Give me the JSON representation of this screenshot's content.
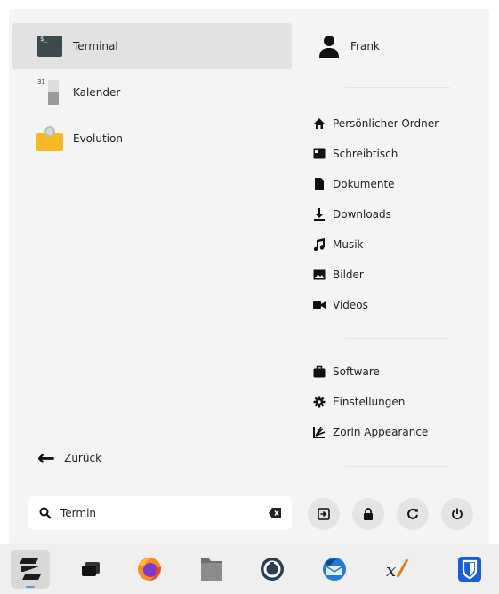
{
  "apps": [
    {
      "label": "Terminal",
      "icon": "terminal-icon",
      "selected": true
    },
    {
      "label": "Kalender",
      "icon": "calendar-icon",
      "selected": false
    },
    {
      "label": "Evolution",
      "icon": "evolution-icon",
      "selected": false
    }
  ],
  "calendar_icon_number": "31",
  "back_label": "Zurück",
  "search": {
    "value": "Termin",
    "placeholder": ""
  },
  "user": {
    "name": "Frank"
  },
  "places": [
    {
      "label": "Persönlicher Ordner",
      "icon": "home-icon"
    },
    {
      "label": "Schreibtisch",
      "icon": "desktop-icon"
    },
    {
      "label": "Dokumente",
      "icon": "document-icon"
    },
    {
      "label": "Downloads",
      "icon": "download-icon"
    },
    {
      "label": "Musik",
      "icon": "music-icon"
    },
    {
      "label": "Bilder",
      "icon": "image-icon"
    },
    {
      "label": "Videos",
      "icon": "video-icon"
    }
  ],
  "system": [
    {
      "label": "Software",
      "icon": "software-icon"
    },
    {
      "label": "Einstellungen",
      "icon": "settings-gear-icon"
    },
    {
      "label": "Zorin Appearance",
      "icon": "zorin-appearance-icon"
    }
  ],
  "actions": [
    "logout-icon",
    "lock-icon",
    "restart-icon",
    "power-icon"
  ],
  "taskbar": [
    "zorin-menu-icon",
    "window-switcher-icon",
    "firefox-icon",
    "files-icon",
    "timeshift-icon",
    "thunderbird-icon",
    "xournal-icon",
    "bitwarden-icon"
  ],
  "colors": {
    "accent": "#5a9bd8",
    "selected_row": "#e2e2e2",
    "menu_bg": "#f4f4f4",
    "evolution": "#f5b921",
    "bitwarden": "#175ddc"
  }
}
